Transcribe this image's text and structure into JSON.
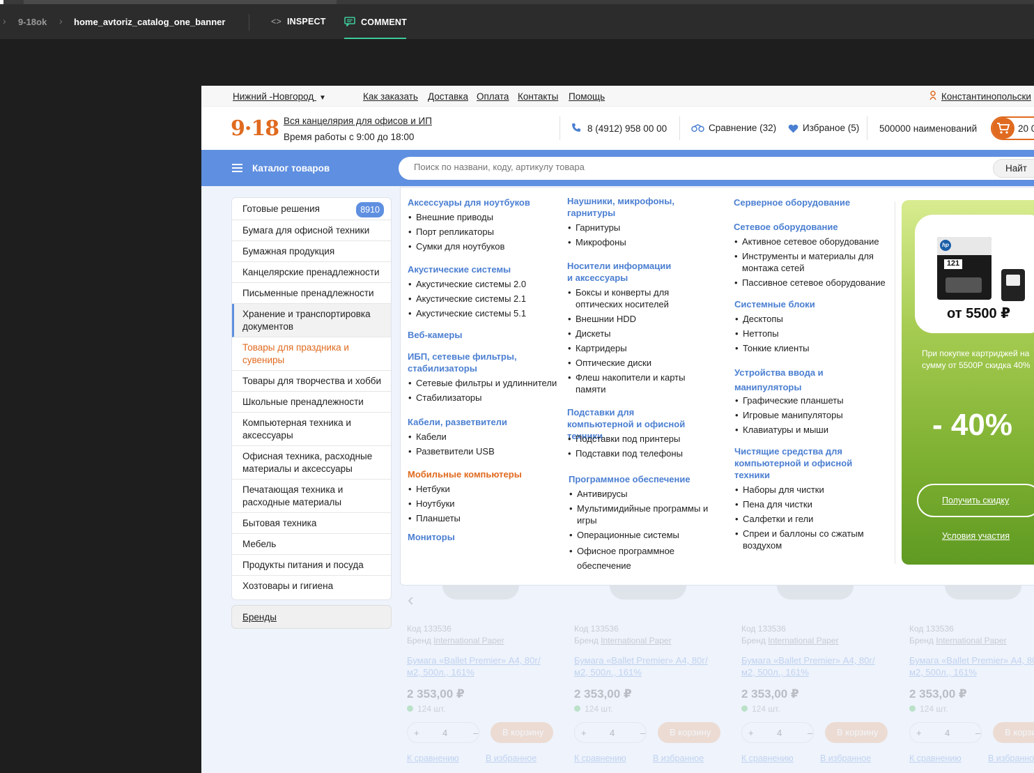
{
  "toolbar": {
    "crumbs": [
      "9-18ok",
      "home_avtoriz_catalog_one_banner"
    ],
    "tabs": {
      "inspect": "INSPECT",
      "comment": "COMMENT"
    }
  },
  "site": {
    "topbar": {
      "city": "Нижний -Новгород",
      "links": [
        "Как заказать",
        "Доставка",
        "Оплата",
        "Контакты",
        "Помощь"
      ],
      "user": "Константинопольски"
    },
    "header": {
      "logo": "9·18",
      "tagline": "Вся канцелярия для офисов и ИП",
      "hours": "Время работы с 9:00 до 18:00",
      "phone": "8 (4912) 958 00 00",
      "compare": "Сравнение (32)",
      "favorites": "Избраное (5)",
      "items_count": "500000 наименований",
      "cart_amount": "20 0"
    },
    "catalog": {
      "title": "Каталог товаров",
      "search_placeholder": "Поиск по названи, коду, артикулу товара",
      "search_button": "Найт"
    },
    "sidebar": {
      "items": [
        "Готовые решения",
        "Бумага для офисной техники",
        "Бумажная продукция",
        "Канцелярские пренадлежности",
        "Письменные пренадлежности",
        "Хранение и транспортировка документов",
        "Товары для праздника и сувениры",
        "Товары для творчества и хобби",
        "Школьные пренадлежности",
        "Компьютерная техника и аксессуары",
        "Офисная техника, расходные материалы и аксессуары",
        "Печатающая техника и расходные материалы",
        "Бытовая техника",
        "Мебель",
        "Продукты питания и посуда",
        "Хозтовары и гигиена"
      ],
      "badge": "8910",
      "brands": "Бренды"
    },
    "mega": {
      "col1": [
        {
          "h": "Аксессуары для ноутбуков",
          "items": [
            "Внешние приводы",
            "Порт репликаторы",
            "Сумки для ноутбуков"
          ]
        },
        {
          "h": "Акустические системы",
          "items": [
            "Акустические системы 2.0",
            "Акустические системы 2.1",
            "Акустические системы 5.1"
          ]
        },
        {
          "h": "Веб-камеры",
          "items": []
        },
        {
          "h": "ИБП, сетевые фильтры, стабилизаторы",
          "items": [
            "Сетевые фильтры и удлиннители",
            "Стабилизаторы"
          ]
        },
        {
          "h": "Кабели, разветвители",
          "items": [
            "Кабели",
            "Разветвители USB"
          ]
        },
        {
          "h": "Мобильные компьютеры",
          "items": [
            "Нетбуки",
            "Ноутбуки",
            "Планшеты"
          ]
        },
        {
          "h": "Мониторы",
          "items": []
        }
      ],
      "col2": [
        {
          "h": "Наушники, микрофоны, гарнитуры",
          "items": [
            "Гарнитуры",
            "Микрофоны"
          ]
        },
        {
          "h": "Носители информации и аксессуары",
          "items": [
            "Боксы и конверты для оптических носителей",
            "Внешнии HDD",
            "Дискеты",
            "Картридеры",
            "Оптические диски",
            "Флеш накопители и карты памяти"
          ]
        },
        {
          "h": "Подставки для компьютерной и офисной техники",
          "items": [
            "Подставки под принтеры",
            "Подставки под телефоны"
          ]
        },
        {
          "h": "Программное обеспечение",
          "items": [
            "Антивирусы",
            "Мультимидийные программы и игры",
            "Операционные системы",
            "Офисное программное обеспечение"
          ]
        }
      ],
      "col3": [
        {
          "h": "Серверное оборудование",
          "items": []
        },
        {
          "h": "Сетевое оборудование",
          "items": [
            "Активное сетевое оборудование",
            "Инструменты и материалы для монтажа сетей",
            "Пассивное сетевое оборудование"
          ]
        },
        {
          "h": "Системные блоки",
          "items": [
            "Десктопы",
            "Неттопы",
            "Тонкие клиенты"
          ]
        },
        {
          "h": "Устройства ввода и манипуляторы",
          "items": [
            "Графические планшеты",
            "Игровые манипуляторы",
            "Клавиатуры и мыши"
          ]
        },
        {
          "h": "Чистящие средства для компьютерной и офисной техники",
          "items": [
            "Наборы для чистки",
            "Пена для чистки",
            "Салфетки и гели",
            "Спреи и баллоны со сжатым воздухом"
          ]
        }
      ]
    },
    "banner": {
      "price": "от 5500 ₽",
      "cartridge_number": "121",
      "description": "При покупке картриджей на сумму от 5500Р скидка 40%",
      "discount": "- 40%",
      "button": "Получить скидку",
      "conditions": "Условия участия"
    },
    "product": {
      "code": "Код 133536",
      "brand_label": "Бренд",
      "brand": "International Paper",
      "name": "Бумага «Ballet Premier» А4, 80г/м2, 500л., 161%",
      "price": "2 353,00 ₽",
      "stock": "124 шт.",
      "qty": "4",
      "to_cart": "В корзину",
      "to_compare": "К сравнению",
      "to_favorites": "В избранное"
    },
    "colors": {
      "accent": "#5f8fe0",
      "brand": "#e06a1f",
      "link": "#4b7fd1",
      "banner_green": "#7fb132"
    }
  }
}
